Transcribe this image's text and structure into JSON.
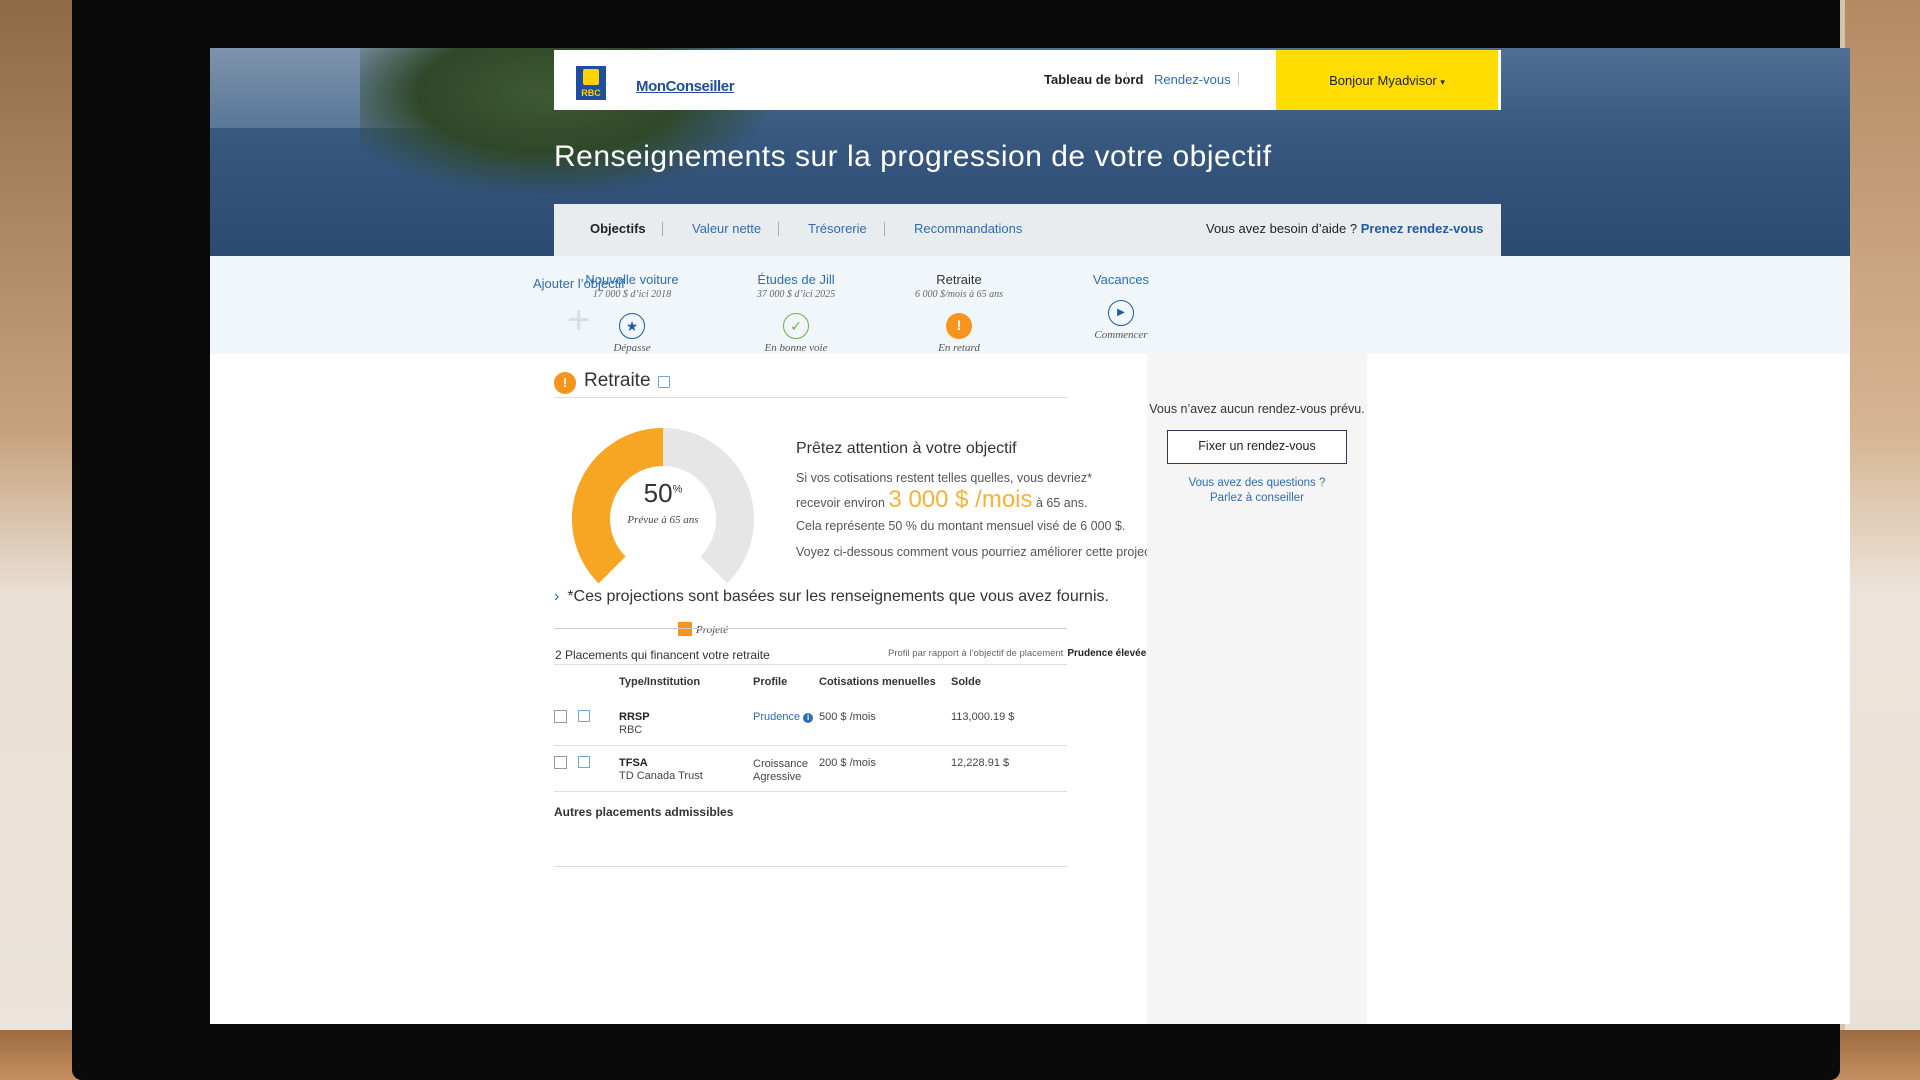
{
  "nav": {
    "logo_text": "RBC",
    "brand": "MonConseiller",
    "dashboard": "Tableau de bord",
    "appointments": "Rendez-vous",
    "greeting": "Bonjour Myadvisor",
    "greeting_caret": "▾"
  },
  "hero": {
    "title": "Renseignements sur la progression de votre objectif"
  },
  "tabs": {
    "objectives": "Objectifs",
    "net_worth": "Valeur nette",
    "treasury": "Trésorerie",
    "recommendations": "Recommandations",
    "help_text": "Vous avez besoin d’aide ?",
    "help_link": "Prenez rendez-vous"
  },
  "goals": {
    "add": "Ajouter l’objectif",
    "items": [
      {
        "name": "Nouvelle voiture",
        "sub": "17 000 $ d’ici 2018",
        "status": "Dépasse",
        "icon": "star-icon"
      },
      {
        "name": "Études de Jill",
        "sub": "37 000 $ d’ici 2025",
        "status": "En bonne voie",
        "icon": "check-icon"
      },
      {
        "name": "Retraite",
        "sub": "6 000 $/mois à 65 ans",
        "status": "En retard",
        "icon": "alert-icon"
      },
      {
        "name": "Vacances",
        "sub": "",
        "status": "Commencer",
        "icon": "play-icon"
      }
    ]
  },
  "section": {
    "title": "Retraite",
    "donut_value": "50",
    "donut_unit": "%",
    "donut_fraction": 0.5,
    "donut_sub": "Prévue à 65 ans",
    "legend": "Projeté",
    "attention_title": "Prêtez attention à votre objectif",
    "line1": "Si vos cotisations restent telles quelles, vous devriez*",
    "line2_pre": "recevoir environ",
    "line2_amount": "3 000 $ /mois",
    "line2_post": "à 65 ans.",
    "line3": "Cela représente  50 % du montant mensuel visé de 6 000 $.",
    "line4": "Voyez ci-dessous comment vous pourriez améliorer cette projection.",
    "note": "*Ces projections sont basées sur les renseignements que vous avez fournis."
  },
  "placements": {
    "header": "2 Placements qui financent votre retraite",
    "profile_label": "Profil par rapport à l’objectif de placement",
    "profile_value": "Prudence élevée",
    "columns": [
      "Type/Institution",
      "Profile",
      "Cotisations menuelles",
      "Solde"
    ],
    "rows": [
      {
        "type": "RRSP",
        "institution": "RBC",
        "profile": "Prudence",
        "profile_line2": "",
        "contrib": "500 $ /mois",
        "balance": "113,000.19 $"
      },
      {
        "type": "TFSA",
        "institution": "TD Canada Trust",
        "profile": "Croissance",
        "profile_line2": "Agressive",
        "contrib": "200 $ /mois",
        "balance": "12,228.91  $"
      }
    ],
    "other": "Autres placements admissibles"
  },
  "panel": {
    "no_appointment": "Vous n’avez aucun rendez-vous prévu.",
    "fix_button": "Fixer un rendez-vous",
    "questions_1": "Vous avez des questions ?",
    "questions_2": "Parlez à conseiller"
  },
  "colors": {
    "accent_yellow": "#ffdd00",
    "brand_blue": "#1f4ea0",
    "warning_orange": "#f7941d",
    "link_blue": "#2c6db5"
  }
}
